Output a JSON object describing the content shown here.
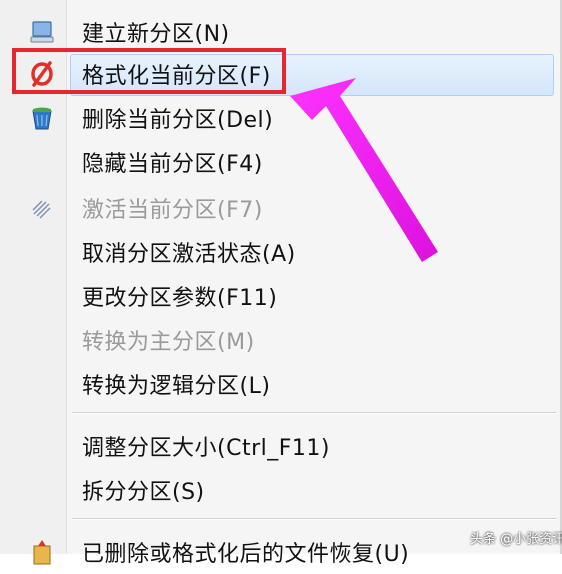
{
  "menu": {
    "items": [
      {
        "label": "建立新分区(N)",
        "icon": "new-partition-icon",
        "disabled": false
      },
      {
        "label": "格式化当前分区(F)",
        "icon": "format-icon",
        "disabled": false,
        "highlighted": true
      },
      {
        "label": "删除当前分区(Del)",
        "icon": "delete-bin-icon",
        "disabled": false
      },
      {
        "label": "隐藏当前分区(F4)",
        "icon": "",
        "disabled": false
      },
      {
        "label": "激活当前分区(F7)",
        "icon": "activate-icon",
        "disabled": true
      },
      {
        "label": "取消分区激活状态(A)",
        "icon": "",
        "disabled": false
      },
      {
        "label": "更改分区参数(F11)",
        "icon": "",
        "disabled": false
      },
      {
        "label": "转换为主分区(M)",
        "icon": "",
        "disabled": true
      },
      {
        "label": "转换为逻辑分区(L)",
        "icon": "",
        "disabled": false
      },
      {
        "label": "调整分区大小(Ctrl_F11)",
        "icon": "",
        "disabled": false
      },
      {
        "label": "拆分分区(S)",
        "icon": "",
        "disabled": false
      },
      {
        "label": "已删除或格式化后的文件恢复(U)",
        "icon": "recover-files-icon",
        "disabled": false
      }
    ]
  },
  "colors": {
    "highlight_box": "#e5282d",
    "arrow": "#ee22ee",
    "format_icon": "#e0302a"
  },
  "watermark": "头条 @小张资讯"
}
